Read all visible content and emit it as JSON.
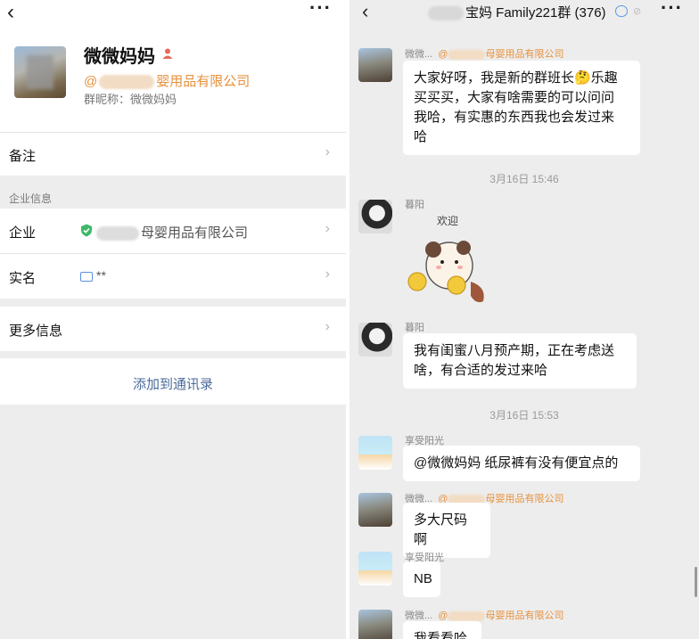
{
  "left": {
    "back": "‹",
    "more": "···",
    "profile": {
      "name": "微微妈妈",
      "company_prefix": "@",
      "company_suffix": "婴用品有限公司",
      "nickname": "群昵称：微微妈妈"
    },
    "rows": {
      "remark": "备注",
      "section_label": "企业信息",
      "enterprise_label": "企业",
      "enterprise_value": "母婴用品有限公司",
      "realname_label": "实名",
      "realname_value": "**",
      "more_info": "更多信息",
      "chevron": "›"
    },
    "add_contact": "添加到通讯录"
  },
  "right": {
    "back": "‹",
    "title": "宝妈 Family221群 (376)",
    "more": "···",
    "messages": [
      {
        "sender_name": "微微...",
        "sender_org": "@",
        "sender_org_suffix": "母婴用品有限公司",
        "text_lines": [
          "大家好呀，我是新的群班长🤔乐趣",
          "买买买，大家有啥需要的可以问问",
          "我哈，有实惠的东西我也会发过来",
          "哈"
        ]
      },
      {
        "timestamp": "3月16日 15:46"
      },
      {
        "sender_name": "暮阳",
        "sticker_text": "欢迎"
      },
      {
        "sender_name": "暮阳",
        "text_lines": [
          "我有闺蜜八月预产期，正在考虑送",
          "啥，有合适的发过来哈"
        ]
      },
      {
        "timestamp": "3月16日 15:53"
      },
      {
        "sender_name": "享受阳光",
        "text_lines": [
          "@微微妈妈 纸尿裤有没有便宜点的"
        ]
      },
      {
        "sender_name": "微微...",
        "sender_org": "@",
        "sender_org_suffix": "母婴用品有限公司",
        "text_lines": [
          "多大尺码啊"
        ]
      },
      {
        "sender_name": "享受阳光",
        "text_lines": [
          "NB"
        ]
      },
      {
        "sender_name": "微微...",
        "sender_org": "@",
        "sender_org_suffix": "母婴用品有限公司",
        "text_lines": [
          "我看看哈"
        ]
      }
    ]
  }
}
